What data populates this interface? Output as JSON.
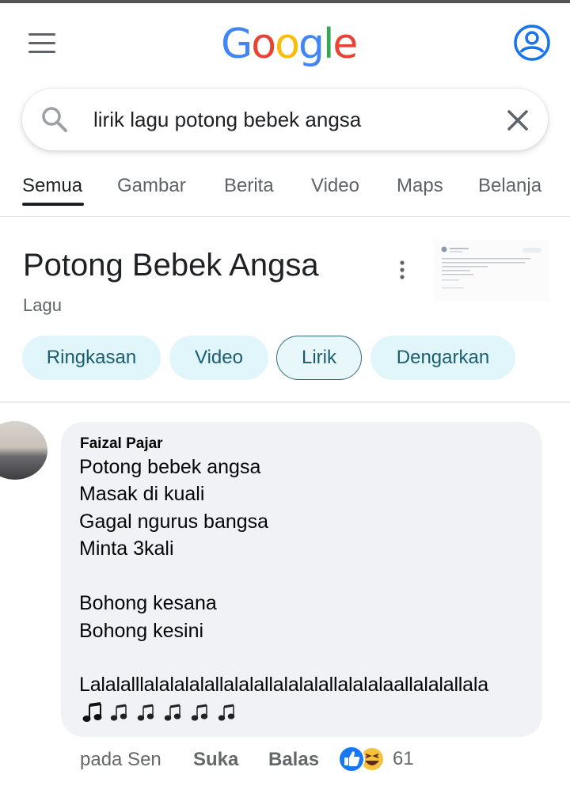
{
  "header": {
    "logo_letters": [
      "G",
      "o",
      "o",
      "g",
      "l",
      "e"
    ],
    "menu_icon": "hamburger-menu-icon",
    "account_icon": "account-circle-icon"
  },
  "search": {
    "query": "lirik lagu potong bebek angsa",
    "search_icon": "search-icon",
    "clear_icon": "close-icon"
  },
  "tabs": [
    "Semua",
    "Gambar",
    "Berita",
    "Video",
    "Maps",
    "Belanja"
  ],
  "knowledge_panel": {
    "title": "Potong Bebek Angsa",
    "subtitle": "Lagu",
    "chips": [
      "Ringkasan",
      "Video",
      "Lirik",
      "Dengarkan"
    ],
    "selected_chip": "Lirik"
  },
  "comment": {
    "author": "Faizal Pajar",
    "lines": [
      "Potong bebek angsa",
      "Masak di kuali",
      "Gagal ngurus bangsa",
      "Minta 3kali",
      "",
      "Bohong kesana",
      "Bohong kesini",
      "",
      "Lalalalllalalalalallalalallalalalallalalalaallalalallala"
    ],
    "time": "pada Sen",
    "like_label": "Suka",
    "reply_label": "Balas",
    "reaction_count": "61",
    "reaction_icons": [
      "like-icon",
      "haha-icon"
    ]
  },
  "colors": {
    "google_blue": "#4285f4",
    "google_red": "#ea4335",
    "google_yellow": "#fbbc05",
    "google_green": "#34a853",
    "chip_bg": "#e0f6fa",
    "bubble_bg": "#f0f2f5"
  }
}
